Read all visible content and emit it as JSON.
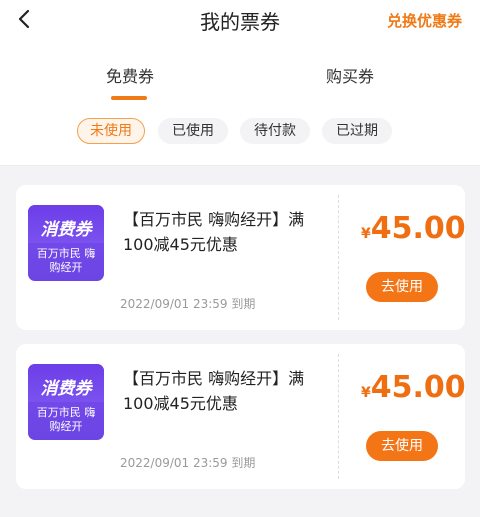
{
  "header": {
    "title": "我的票券",
    "redeem_label": "兑换优惠券"
  },
  "tabs": [
    {
      "label": "免费券",
      "active": true
    },
    {
      "label": "购买券",
      "active": false
    }
  ],
  "filters": [
    {
      "label": "未使用",
      "active": true
    },
    {
      "label": "已使用",
      "active": false
    },
    {
      "label": "待付款",
      "active": false
    },
    {
      "label": "已过期",
      "active": false
    }
  ],
  "coupons": [
    {
      "badge_title": "消费券",
      "badge_subtitle": "百万市民 嗨购经开",
      "title": "【百万市民 嗨购经开】满100减45元优惠",
      "expiry": "2022/09/01 23:59 到期",
      "currency": "¥",
      "amount": "45.00",
      "button_label": "去使用"
    },
    {
      "badge_title": "消费券",
      "badge_subtitle": "百万市民 嗨购经开",
      "title": "【百万市民 嗨购经开】满100减45元优惠",
      "expiry": "2022/09/01 23:59 到期",
      "currency": "¥",
      "amount": "45.00",
      "button_label": "去使用"
    }
  ],
  "colors": {
    "accent": "#f07a16",
    "badge": "#6f47e8",
    "background": "#f3f3f5"
  }
}
